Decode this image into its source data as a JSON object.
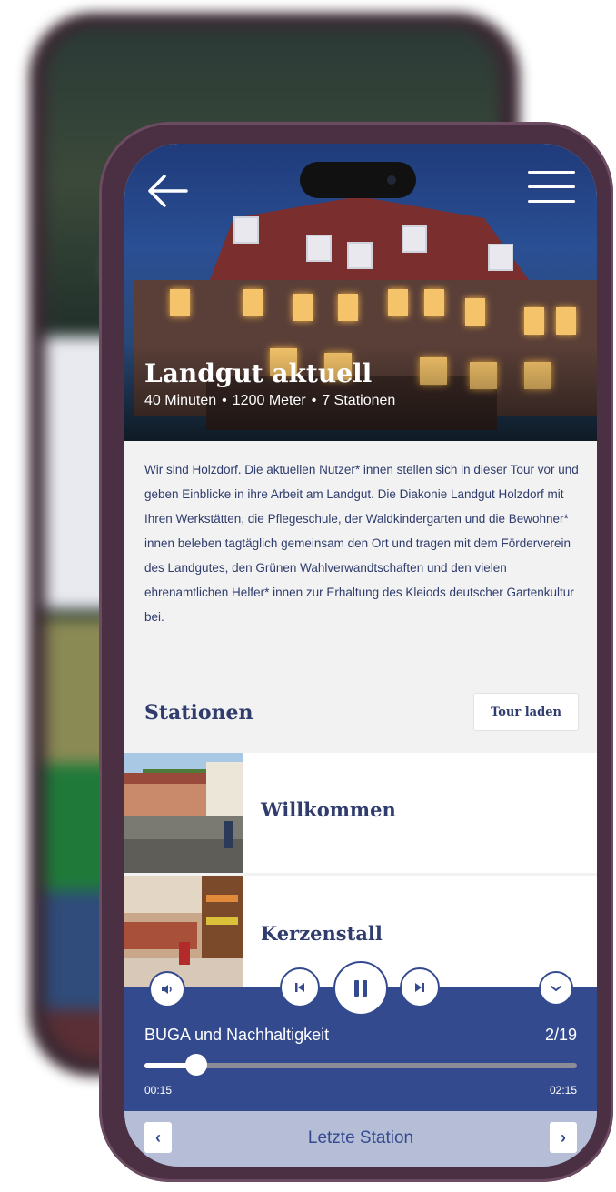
{
  "hero": {
    "title": "Landgut aktuell",
    "duration": "40 Minuten",
    "distance": "1200 Meter",
    "stations": "7 Stationen",
    "separator": "•"
  },
  "description": "Wir sind Holzdorf. Die aktuellen Nutzer* innen stellen sich in dieser Tour vor und geben Einblicke in ihre Arbeit am Landgut. Die Diakonie Landgut Holzdorf mit Ihren Werkstätten, die Pflegeschule, der Waldkindergarten und die Bewohner* innen beleben tagtäglich gemeinsam den Ort und tragen mit dem Förderverein des Landgutes, den Grünen Wahlverwandtschaften und den vielen ehrenamtlichen Helfer* innen zur Erhaltung des Kleiods deutscher Gartenkultur bei.",
  "stations_section": {
    "heading": "Stationen",
    "tour_button": "Tour laden",
    "items": [
      {
        "label": "Willkommen"
      },
      {
        "label": "Kerzenstall"
      }
    ]
  },
  "player": {
    "track_title": "BUGA und Nachhaltigkeit",
    "track_position": "2/19",
    "current_time": "00:15",
    "total_time": "02:15",
    "progress_fraction": 0.12,
    "icons": [
      "volume-icon",
      "skip-previous-icon",
      "pause-icon",
      "skip-next-icon",
      "collapse-icon"
    ]
  },
  "bottom_nav": {
    "label": "Letzte Station",
    "prev_symbol": "‹",
    "next_symbol": "›"
  },
  "colors": {
    "accent": "#344a8f",
    "text_dark": "#2f3c6d",
    "phone_frame": "#4b2f42"
  }
}
